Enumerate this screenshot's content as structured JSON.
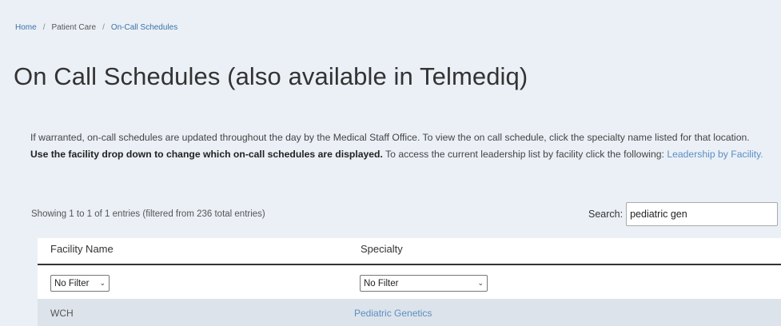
{
  "breadcrumb": {
    "home": "Home",
    "separator": "/",
    "patient_care": "Patient Care",
    "current": "On-Call Schedules"
  },
  "page_title": "On Call Schedules (also available in Telmediq)",
  "intro": {
    "text1": "If warranted, on-call schedules are updated throughout the day by the Medical Staff Office. To view the on call schedule, click the specialty name listed for that location.",
    "bold": "Use the facility drop down to change which on-call schedules are displayed.",
    "text2": "To access the current leadership list by facility click the following:",
    "link": "Leadership by Facility."
  },
  "table_info": "Showing 1 to 1 of 1 entries (filtered from 236 total entries)",
  "search": {
    "label": "Search:",
    "value": "pediatric gen"
  },
  "table": {
    "columns": [
      "Facility Name",
      "Specialty"
    ],
    "filters": [
      {
        "selected": "No Filter"
      },
      {
        "selected": "No Filter"
      }
    ],
    "rows": [
      {
        "facility": "WCH",
        "specialty": "Pediatric Genetics"
      }
    ]
  },
  "colors": {
    "background": "#ebf0f6",
    "link": "#3b73a6",
    "row_highlight": "#dde3ea"
  }
}
